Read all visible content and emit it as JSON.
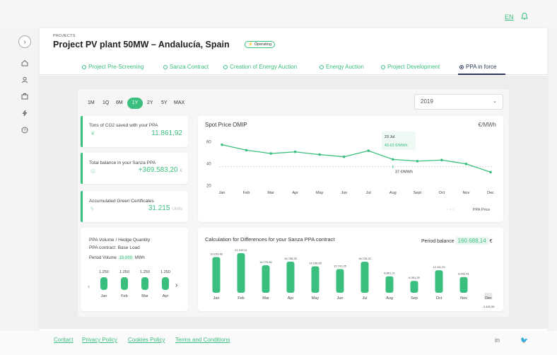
{
  "header": {
    "lang": "EN"
  },
  "breadcrumb": "PROJECTS",
  "project": {
    "title": "Project PV plant 50MW – Andalucía, Spain",
    "status": "Operating"
  },
  "tabs": [
    {
      "label": "Project Pre-Screening"
    },
    {
      "label": "Sanza Contract"
    },
    {
      "label": "Creation of Energy Auction"
    },
    {
      "label": "Energy Auction"
    },
    {
      "label": "Project Development"
    },
    {
      "label": "PPA in force"
    }
  ],
  "ranges": [
    "1M",
    "1Q",
    "6M",
    "1Y",
    "2Y",
    "5Y",
    "MAX"
  ],
  "year_select": "2019",
  "cards": {
    "co2": {
      "label": "Tons of CO2 saved with your PPA",
      "value": "11.861,92"
    },
    "balance": {
      "label": "Total balance in your Sanza PPA",
      "value": "+369.583,20",
      "unit": "€"
    },
    "certs": {
      "label": "Accumulated Green Certificates",
      "value": "31.215",
      "unit": "Units"
    }
  },
  "volume": {
    "title": "PPA Volume / Hedge Quantity",
    "subtitle": "PPA contract: Base Load",
    "period_label": "Period Volume",
    "period_value": "15.000",
    "period_unit": "MWh",
    "months": [
      "Jan",
      "Feb",
      "Mar",
      "Apr"
    ],
    "values": [
      "1.250",
      "1.250",
      "1.250",
      "1.250"
    ]
  },
  "spot": {
    "title": "Spot Price OMIP",
    "unit": "€/MWh",
    "tooltip_date": "23 Jul",
    "tooltip_value": "43.63 €/MWh",
    "ref_label": "37 €/MWh",
    "legend": "PPA Price"
  },
  "cfd": {
    "title": "Calculation for Differences for your Sanza PPA contract",
    "balance_label": "Period balance",
    "balance_value": "160.688,14",
    "balance_unit": "€"
  },
  "footer": {
    "links": [
      "Contact",
      "Privacy Policy",
      "Cookies Policy",
      "Terms and Conditions"
    ]
  },
  "colors": {
    "accent": "#3bbf7e",
    "navy": "#2d3a5a"
  },
  "chart_data": [
    {
      "type": "line",
      "title": "Spot Price OMIP",
      "categories": [
        "Jan",
        "Feb",
        "Mar",
        "Apr",
        "May",
        "Jun",
        "Jul",
        "Aug",
        "Sept",
        "Oct",
        "Nov",
        "Dec"
      ],
      "values": [
        57,
        52,
        49,
        50.5,
        48,
        46,
        51.5,
        43.63,
        42,
        43,
        39.5,
        32
      ],
      "ylim": [
        20,
        60
      ],
      "yticks": [
        20,
        40,
        60
      ],
      "reference_line": 37,
      "ylabel": "€/MWh"
    },
    {
      "type": "bar",
      "title": "Calculation for Differences for your Sanza PPA contract",
      "categories": [
        "Jan",
        "Feb",
        "Mar",
        "Apr",
        "May",
        "Jun",
        "Jul",
        "Aug",
        "Sep",
        "Oct",
        "Nov",
        "Dec"
      ],
      "values": [
        19233.46,
        21319.11,
        14779.62,
        16758.33,
        14236.69,
        12741.25,
        16726.22,
        8861.21,
        6391.25,
        12111.29,
        8492.41,
        -3400.55
      ],
      "labels": [
        "19.233,46",
        "21.319,11",
        "14.779,62",
        "16.758,33",
        "14.236,69",
        "12.741,25",
        "16.726,22",
        "8.861,21",
        "6.391,25",
        "12.111,29",
        "8.492,41",
        "-3.400,55"
      ]
    }
  ]
}
